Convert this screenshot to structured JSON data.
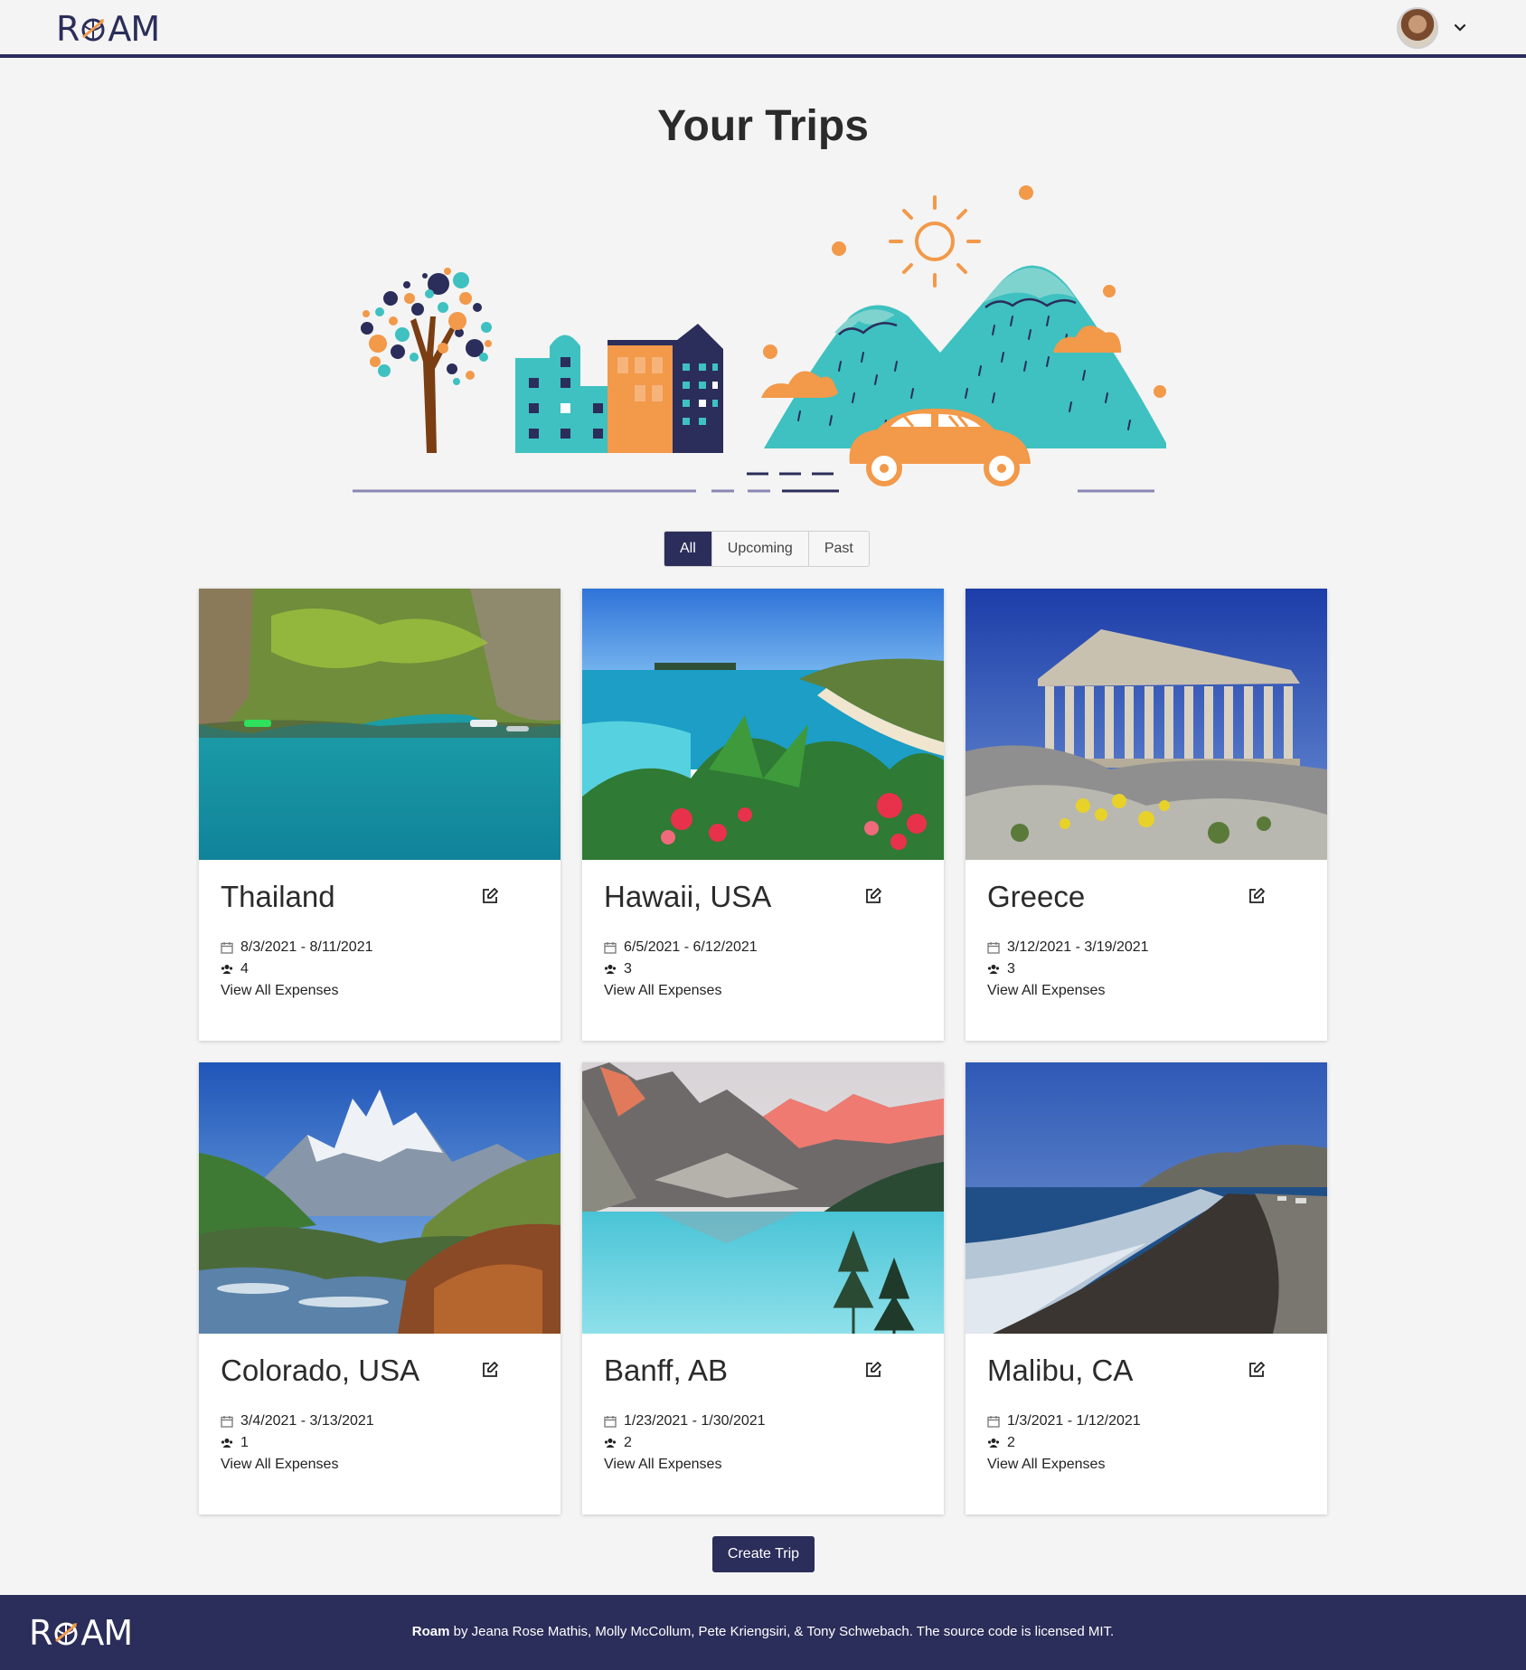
{
  "nav": {
    "logo_prefix": "R",
    "logo_suffix": "AM",
    "avatar_icon": "user-avatar",
    "menu_icon": "chevron-down-icon"
  },
  "header": {
    "title": "Your Trips"
  },
  "filter": {
    "all": "All",
    "upcoming": "Upcoming",
    "past": "Past",
    "active": "All"
  },
  "trips": [
    {
      "name": "Thailand",
      "dates": "8/3/2021 - 8/11/2021",
      "travelers": "4",
      "expenses_link": "View All Expenses"
    },
    {
      "name": "Hawaii, USA",
      "dates": "6/5/2021 - 6/12/2021",
      "travelers": "3",
      "expenses_link": "View All Expenses"
    },
    {
      "name": "Greece",
      "dates": "3/12/2021 - 3/19/2021",
      "travelers": "3",
      "expenses_link": "View All Expenses"
    },
    {
      "name": "Colorado, USA",
      "dates": "3/4/2021 - 3/13/2021",
      "travelers": "1",
      "expenses_link": "View All Expenses"
    },
    {
      "name": "Banff, AB",
      "dates": "1/23/2021 - 1/30/2021",
      "travelers": "2",
      "expenses_link": "View All Expenses"
    },
    {
      "name": "Malibu, CA",
      "dates": "1/3/2021 - 1/12/2021",
      "travelers": "2",
      "expenses_link": "View All Expenses"
    }
  ],
  "actions": {
    "create_label": "Create Trip"
  },
  "footer": {
    "brand": "Roam",
    "credit": " by Jeana Rose Mathis, Molly McCollum, Pete Kriengsiri, & Tony Schwebach. The source code is licensed MIT."
  },
  "colors": {
    "primary": "#2b2d5a",
    "accent": "#f2994a",
    "teal": "#3ec1c0",
    "background": "#f4f4f4"
  }
}
